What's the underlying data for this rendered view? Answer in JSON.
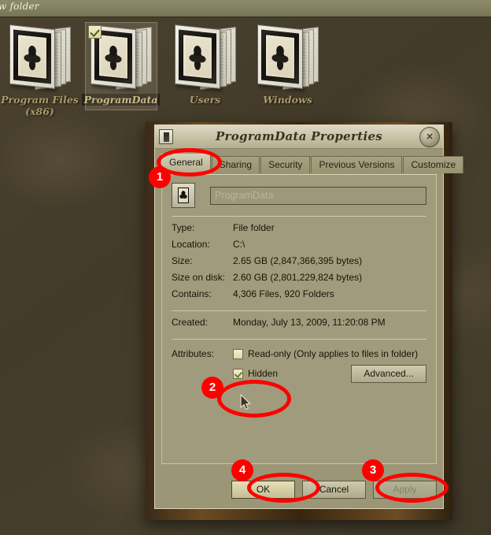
{
  "toolbar": {
    "text": "w folder"
  },
  "desktop": {
    "icons": [
      {
        "label": "Program Files\n(x86)",
        "name": "program-files-x86",
        "selected": false
      },
      {
        "label": "ProgramData",
        "name": "programdata",
        "selected": true
      },
      {
        "label": "Users",
        "name": "users",
        "selected": false
      },
      {
        "label": "Windows",
        "name": "windows",
        "selected": false
      }
    ]
  },
  "dialog": {
    "title": "ProgramData Properties",
    "close_label": "×",
    "tabs": [
      {
        "label": "General",
        "active": true
      },
      {
        "label": "Sharing",
        "active": false
      },
      {
        "label": "Security",
        "active": false
      },
      {
        "label": "Previous Versions",
        "active": false
      },
      {
        "label": "Customize",
        "active": false
      }
    ],
    "name_value": "ProgramData",
    "properties": [
      {
        "key": "Type:",
        "value": "File folder"
      },
      {
        "key": "Location:",
        "value": "C:\\"
      },
      {
        "key": "Size:",
        "value": "2.65 GB (2,847,366,395 bytes)"
      },
      {
        "key": "Size on disk:",
        "value": "2.60 GB (2,801,229,824 bytes)"
      },
      {
        "key": "Contains:",
        "value": "4,306 Files, 920 Folders"
      }
    ],
    "created": {
      "key": "Created:",
      "value": "Monday, July 13, 2009, 11:20:08 PM"
    },
    "attributes": {
      "label": "Attributes:",
      "readonly": {
        "label": "Read-only (Only applies to files in folder)",
        "checked": false
      },
      "hidden": {
        "label": "Hidden",
        "checked": true
      },
      "advanced_label": "Advanced..."
    },
    "buttons": {
      "ok": "OK",
      "cancel": "Cancel",
      "apply": "Apply"
    }
  },
  "annotations": [
    {
      "number": "1",
      "target": "general-tab"
    },
    {
      "number": "2",
      "target": "hidden-checkbox"
    },
    {
      "number": "3",
      "target": "apply-button"
    },
    {
      "number": "4",
      "target": "ok-button"
    }
  ],
  "colors": {
    "annotation": "#ff0000",
    "dialog_face": "#a09b7c",
    "title_bar": "#c9c4a8"
  }
}
